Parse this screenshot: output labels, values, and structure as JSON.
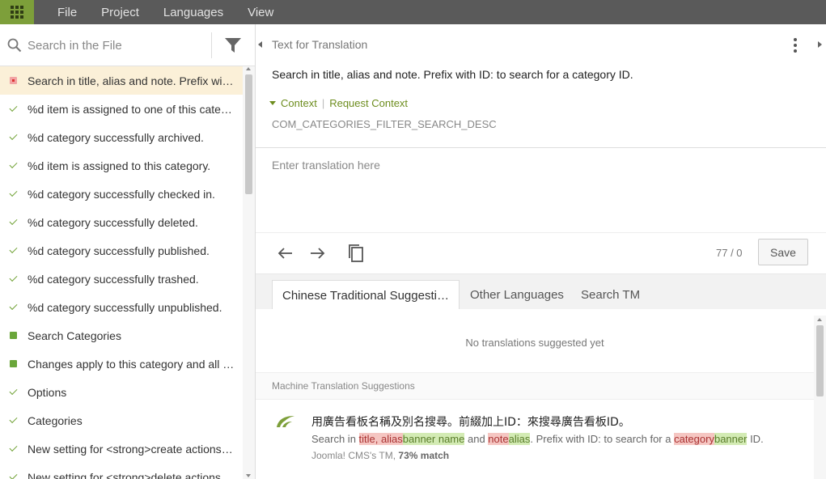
{
  "menu": {
    "apps_icon": "grid-icon",
    "items": [
      "File",
      "Project",
      "Languages",
      "View"
    ]
  },
  "sidebar": {
    "search_placeholder": "Search in the File",
    "items": [
      {
        "status": "untranslated",
        "label": "Search in title, alias and note. Prefix with ID: to search for a category ID."
      },
      {
        "status": "translated",
        "label": "%d item is assigned to one of this category's fields."
      },
      {
        "status": "translated",
        "label": "%d category successfully archived."
      },
      {
        "status": "translated",
        "label": "%d item is assigned to this category."
      },
      {
        "status": "translated",
        "label": "%d category successfully checked in."
      },
      {
        "status": "translated",
        "label": "%d category successfully deleted."
      },
      {
        "status": "translated",
        "label": "%d category successfully published."
      },
      {
        "status": "translated",
        "label": "%d category successfully trashed."
      },
      {
        "status": "translated",
        "label": "%d category successfully unpublished."
      },
      {
        "status": "approved",
        "label": "Search Categories"
      },
      {
        "status": "approved",
        "label": "Changes apply to this category and all child categories."
      },
      {
        "status": "translated",
        "label": "Options"
      },
      {
        "status": "translated",
        "label": "Categories"
      },
      {
        "status": "translated",
        "label": "New setting for <strong>create actions</strong>"
      },
      {
        "status": "translated",
        "label": "New setting for <strong>delete actions</strong>"
      }
    ]
  },
  "editor": {
    "source_label": "Text for Translation",
    "source_text": "Search in title, alias and note. Prefix with ID: to search for a category ID.",
    "context_label": "Context",
    "request_context_label": "Request Context",
    "string_key": "COM_CATEGORIES_FILTER_SEARCH_DESC",
    "translation_placeholder": "Enter translation here",
    "counter": "77 / 0",
    "save_label": "Save"
  },
  "tabs": [
    "Chinese Traditional Suggestions",
    "Other Languages",
    "Search TM"
  ],
  "suggestions": {
    "empty_text": "No translations suggested yet",
    "mt_header": "Machine Translation Suggestions",
    "mt_target": "用廣告看板名稱及別名搜尋。前綴加上ID：來搜尋廣告看板ID。",
    "mt_source_parts": [
      {
        "t": "Search in ",
        "k": "plain"
      },
      {
        "t": "title, alias",
        "k": "del"
      },
      {
        "t": "banner name",
        "k": "ins"
      },
      {
        "t": " and ",
        "k": "plain"
      },
      {
        "t": "note",
        "k": "del"
      },
      {
        "t": "alias",
        "k": "ins"
      },
      {
        "t": ". Prefix with ID: to search for a ",
        "k": "plain"
      },
      {
        "t": "category",
        "k": "del"
      },
      {
        "t": "banner",
        "k": "ins"
      },
      {
        "t": " ID.",
        "k": "plain"
      }
    ],
    "mt_meta_source": "Joomla! CMS's TM, ",
    "mt_meta_match": "73% match"
  },
  "colors": {
    "accent": "#7d9f3a",
    "topbar": "#5a5a5a",
    "active_row": "#fbf0d8",
    "check": "#6b9e2e",
    "untranslated": "#f2a4a4"
  }
}
